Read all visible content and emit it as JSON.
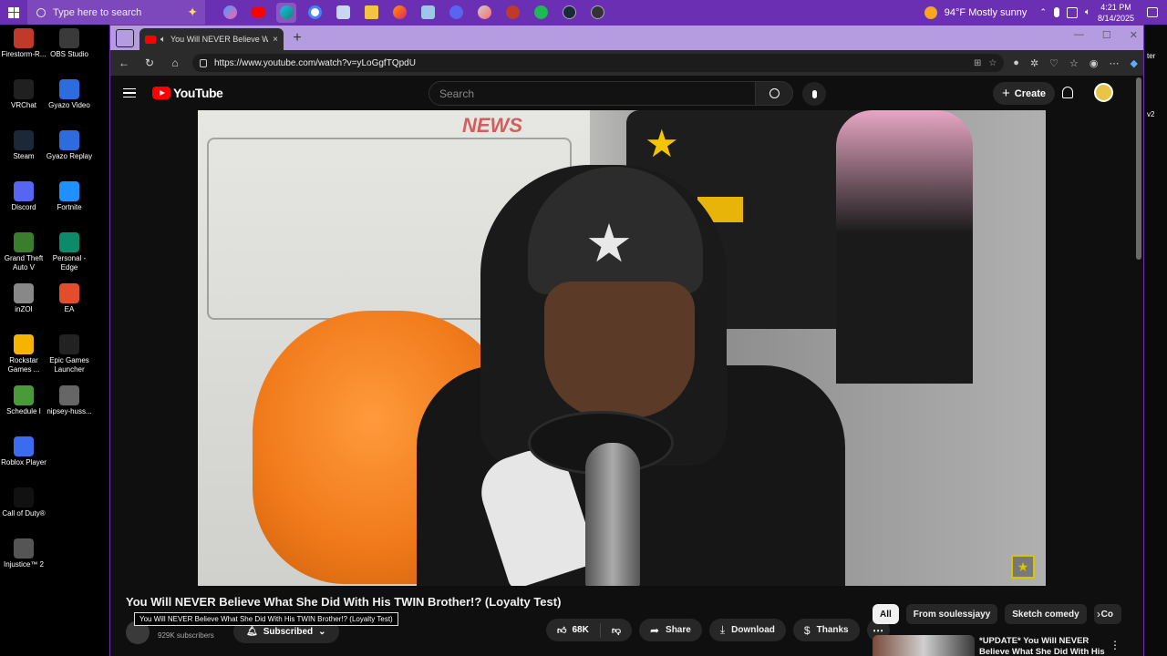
{
  "taskbar": {
    "search_placeholder": "Type here to search",
    "weather": "94°F  Mostly sunny",
    "time": "4:21 PM",
    "date": "8/14/2025",
    "apps": [
      "copilot-app",
      "youtube-app",
      "edge-app",
      "chrome-app",
      "files-app",
      "folder-app",
      "firefox-app",
      "notes-app",
      "discord-app",
      "opera-app",
      "game-app",
      "spotify-app",
      "steam-app",
      "obs-app"
    ]
  },
  "desktop": {
    "icons": [
      {
        "label": "Firestorm-R...",
        "color": "#c0392b"
      },
      {
        "label": "OBS Studio",
        "color": "#3a3a3a"
      },
      {
        "label": "VRChat",
        "color": "#202020"
      },
      {
        "label": "Gyazo Video",
        "color": "#2d6cdf"
      },
      {
        "label": "Steam",
        "color": "#1b2838"
      },
      {
        "label": "Gyazo Replay",
        "color": "#2d6cdf"
      },
      {
        "label": "Discord",
        "color": "#5865f2"
      },
      {
        "label": "Fortnite",
        "color": "#1e90ff"
      },
      {
        "label": "Grand Theft Auto V",
        "color": "#3a7d2c"
      },
      {
        "label": "Personal - Edge",
        "color": "#0c8a6a"
      },
      {
        "label": "inZOI",
        "color": "#888"
      },
      {
        "label": "EA",
        "color": "#e34d2b"
      },
      {
        "label": "Rockstar Games ...",
        "color": "#f5b400"
      },
      {
        "label": "Epic Games Launcher",
        "color": "#222"
      },
      {
        "label": "Schedule I",
        "color": "#4a9a3a"
      },
      {
        "label": "nipsey-huss...",
        "color": "#666"
      },
      {
        "label": "Roblox Player",
        "color": "#3b6cf0"
      },
      {
        "label": "Call of Duty®",
        "color": "#111"
      },
      {
        "label": "Injustice™ 2",
        "color": "#555"
      }
    ]
  },
  "browser": {
    "tab_title": "You Will NEVER Believe What She Did With His TWIN Brother!? (Loyalty Test)",
    "url": "https://www.youtube.com/watch?v=yLoGgfTQpdU",
    "new_tab": "+",
    "close_tab": "×"
  },
  "youtube": {
    "logo": "YouTube",
    "search_placeholder": "Search",
    "create_label": "Create",
    "video_title": "You Will NEVER Believe What She Did With His TWIN Brother!? (Loyalty Test)",
    "tooltip": "You Will NEVER Believe What She Did With His TWIN Brother!? (Loyalty Test)",
    "subscribers": "929K subscribers",
    "subscribed_label": "Subscribed",
    "likes": "68K",
    "share_label": "Share",
    "download_label": "Download",
    "thanks_label": "Thanks",
    "chips": [
      "All",
      "From soulessjayy",
      "Sketch comedy",
      "Co"
    ],
    "rec_title": "*UPDATE* You Will NEVER Believe What She Did With His"
  },
  "right_edge": {
    "text1": "ter",
    "text2": "v2"
  }
}
